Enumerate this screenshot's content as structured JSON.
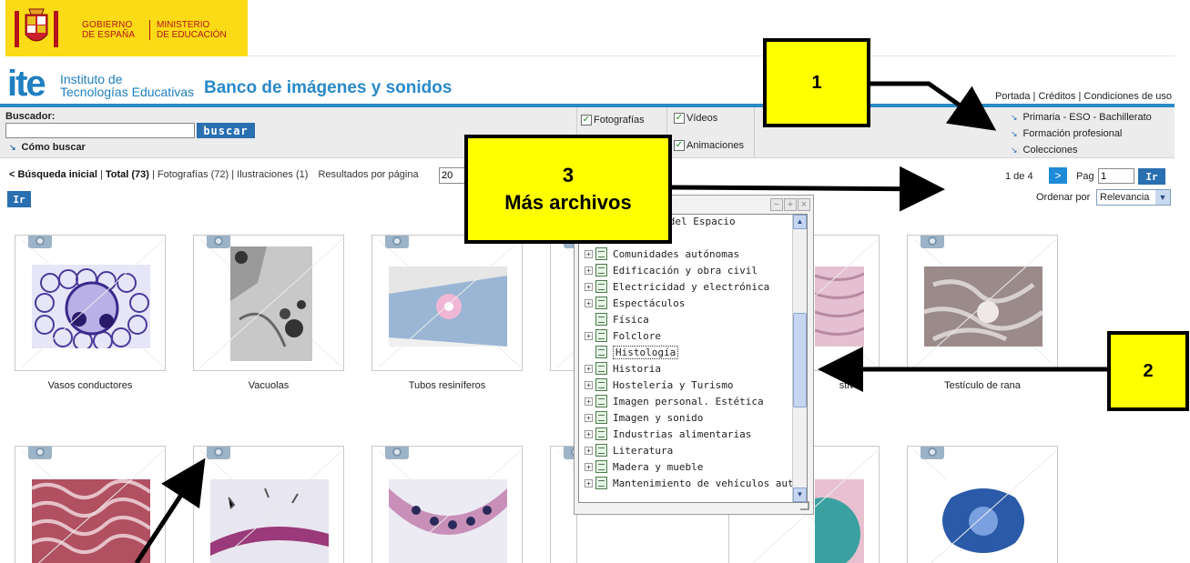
{
  "header": {
    "gov_line1": "GOBIERNO",
    "gov_line2": "DE ESPAÑA",
    "min_line1": "MINISTERIO",
    "min_line2": "DE EDUCACIÓN",
    "ite_logo": "ite",
    "ite_name_1": "Instituto de",
    "ite_name_2": "Tecnologías Educativas",
    "site_title": "Banco de imágenes y sonidos",
    "top_links": "Portada | Créditos | Condiciones de uso",
    "brand_color": "#1e7fc1",
    "gov_color": "#fbdb15"
  },
  "search": {
    "label": "Buscador:",
    "value": "",
    "button": "buscar",
    "help_link": "Cómo buscar",
    "filters": [
      {
        "label": "Fotografías",
        "checked": true
      },
      {
        "label": "Vídeos",
        "checked": true
      },
      {
        "label": "Animaciones",
        "checked": true
      }
    ],
    "nav_links": [
      "Primaria - ESO - Bachillerato",
      "Formación profesional",
      "Colecciones"
    ]
  },
  "results": {
    "back_link": "< Búsqueda inicial",
    "total": "Total (73)",
    "counts": "| Fotografías (72) | Ilustraciones (1)",
    "per_page_label": "Resultados por página",
    "per_page_value": "20",
    "ir_label": "Ir",
    "pager_text": "1 de 4",
    "pager_next": ">",
    "pag_label": "Pag",
    "pag_value": "1",
    "order_label": "Ordenar por",
    "order_value": "Relevancia"
  },
  "thumbnails": [
    {
      "caption": "Vasos conductores"
    },
    {
      "caption": "Vacuolas"
    },
    {
      "caption": "Tubos resiníferos"
    },
    {
      "caption": ""
    },
    {
      "caption": "stivo"
    },
    {
      "caption": "Testículo de rana"
    },
    {
      "caption": ""
    },
    {
      "caption": ""
    },
    {
      "caption": ""
    },
    {
      "caption": ""
    },
    {
      "caption": ""
    },
    {
      "caption": ""
    }
  ],
  "popup": {
    "items": [
      {
        "label": "e la Tierra y del Espacio",
        "expandable": false
      },
      {
        "label": "Comunidades autónomas",
        "expandable": true
      },
      {
        "label": "Edificación y obra civil",
        "expandable": true
      },
      {
        "label": "Electricidad y electrónica",
        "expandable": true
      },
      {
        "label": "Espectáculos",
        "expandable": true
      },
      {
        "label": "Física",
        "expandable": false
      },
      {
        "label": "Folclore",
        "expandable": true
      },
      {
        "label": "Histología",
        "expandable": false,
        "selected": true
      },
      {
        "label": "Historia",
        "expandable": true
      },
      {
        "label": "Hostelería y Turismo",
        "expandable": true
      },
      {
        "label": "Imagen personal. Estética",
        "expandable": true
      },
      {
        "label": "Imagen y sonido",
        "expandable": true
      },
      {
        "label": "Industrias alimentarias",
        "expandable": true
      },
      {
        "label": "Literatura",
        "expandable": true
      },
      {
        "label": "Madera y mueble",
        "expandable": true
      },
      {
        "label": "Mantenimiento de vehículos autor",
        "expandable": true
      }
    ]
  },
  "callouts": {
    "c1": "1",
    "c2": "2",
    "c3_num": "3",
    "c3_text": "Más archivos"
  }
}
